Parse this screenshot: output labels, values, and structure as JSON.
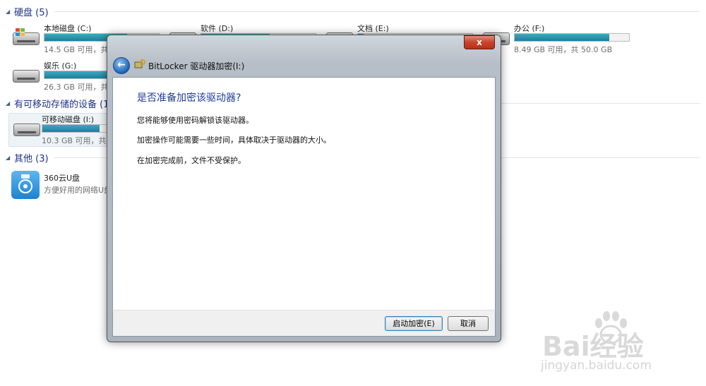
{
  "groups": {
    "hard_disks": "硬盘 (5)",
    "removable": "有可移动存储的设备 (1",
    "other": "其他 (3)"
  },
  "drives": [
    {
      "name": "本地磁盘 (C:)",
      "info": "14.5 GB 可用，共",
      "used_fraction": 0.72
    },
    {
      "name": "软件 (D:)",
      "info": "",
      "used_fraction": 0.6
    },
    {
      "name": "文档 (E:)",
      "info": "",
      "used_fraction": 0.05
    },
    {
      "name": "办公 (F:)",
      "info": "8.49 GB 可用，共 50.0 GB",
      "used_fraction": 0.83
    },
    {
      "name": "娱乐 (G:)",
      "info": "26.3 GB 可用，共",
      "used_fraction": 0.6
    }
  ],
  "removable_drive": {
    "name": "可移动磁盘 (I:)",
    "info": "10.3 GB 可用，共",
    "used_fraction": 0.5
  },
  "other_item": {
    "name": "360云U盘",
    "desc": "方便好用的网络U盘"
  },
  "dialog": {
    "close_glyph": "x",
    "back_glyph": "←",
    "title": "BitLocker 驱动器加密(I:)",
    "heading": "是否准备加密该驱动器?",
    "lines": [
      "您将能够使用密码解锁该驱动器。",
      "加密操作可能需要一些时间，具体取决于驱动器的大小。",
      "在加密完成前，文件不受保护。"
    ],
    "start_button": "启动加密(E)",
    "cancel_button": "取消"
  },
  "watermark": {
    "text": "Bai经验",
    "url": "jingyan.baidu.com"
  },
  "colors": {
    "accent": "#1e3c9a",
    "bar_fill": "#1d7f9c",
    "close_red": "#c8432c"
  }
}
